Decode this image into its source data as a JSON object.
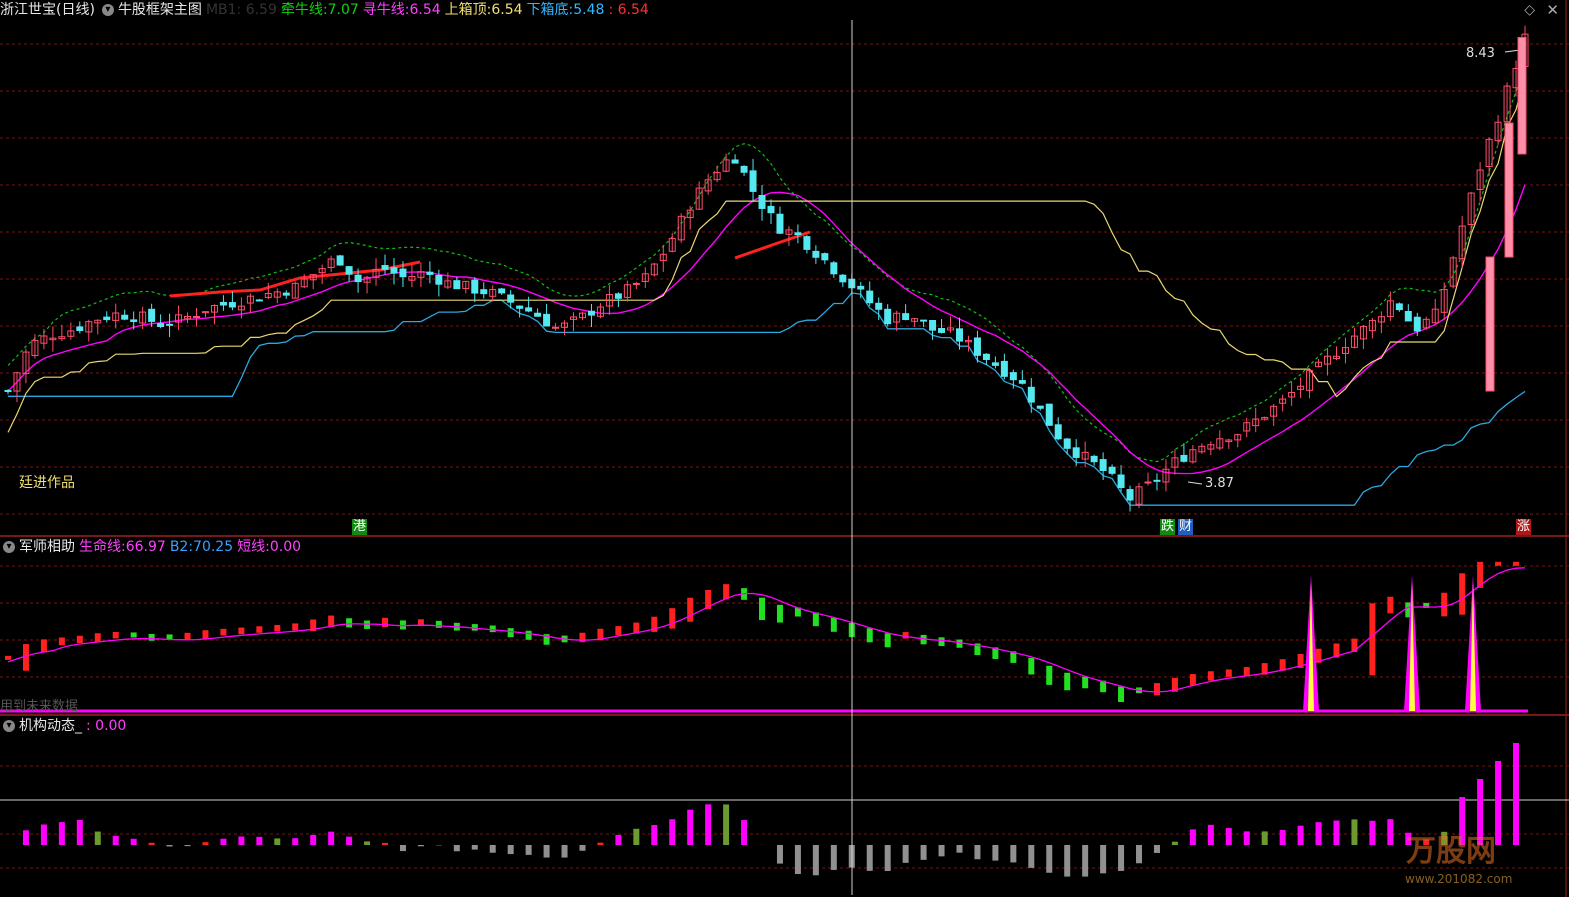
{
  "colors": {
    "up": "#ff4d6d",
    "up_fill": "#ff8fa8",
    "down": "#54e8f0",
    "ma_green": "#10c010",
    "magenta": "#ff00ff",
    "red_line": "#ff2020",
    "yellow_line": "#e8d870",
    "blue_line": "#2aa8e0",
    "grid": "#7a1515",
    "white": "#dddddd",
    "yellow": "#ffff40",
    "purple": "#b5318f",
    "gray": "#909090",
    "olive": "#6a9a30"
  },
  "header": {
    "title": "浙江世宝(日线)",
    "template": "牛股框架主图",
    "mb1_label": "MB1: 6.59",
    "qianniu_label": "牵牛线:",
    "qianniu_value": "7.07",
    "xunniu_label": "寻牛线:",
    "xunniu_value": "6.54",
    "shang_label": "上箱顶:",
    "shang_value": "6.54",
    "xia_label": "下箱底:",
    "xia_value": "5.48",
    "extra_value": ": 6.54"
  },
  "main_panel": {
    "signature": "廷进作品",
    "price_high_label": "8.43",
    "price_low_label": "3.87",
    "tags": [
      {
        "text": "港",
        "color": "#128a12"
      },
      {
        "text": "跌",
        "color": "#128a12"
      },
      {
        "text": "财",
        "color": "#1f5fbf"
      },
      {
        "text": "涨",
        "color": "#b01818"
      }
    ]
  },
  "panel2": {
    "name": "军师相助",
    "smx_label": "生命线:",
    "smx_value": "66.97",
    "b2_label": "B2:",
    "b2_value": "70.25",
    "dx_label": "短线:",
    "dx_value": "0.00",
    "warning": "用到未来数据"
  },
  "panel3": {
    "name": "机构动态_",
    "value": ": 0.00"
  },
  "watermark": {
    "text": "万股网",
    "url": "www.201082.com"
  },
  "icons": [
    "chevron-down-icon",
    "diamond-icon",
    "close-icon"
  ],
  "chart_data": [
    {
      "type": "candlestick",
      "title": "浙江世宝(日线)",
      "price_extremes": {
        "high": 8.43,
        "low": 3.87
      },
      "indicators": {
        "牵牛线": 7.07,
        "寻牛线": 6.54,
        "上箱顶": 6.54,
        "下箱底": 5.48
      },
      "close_path": [
        5.0,
        5.45,
        5.55,
        5.6,
        5.7,
        5.75,
        5.72,
        5.65,
        5.7,
        5.8,
        5.85,
        5.9,
        5.95,
        6.0,
        6.15,
        6.3,
        6.05,
        6.2,
        6.1,
        6.15,
        6.05,
        6.0,
        5.95,
        5.85,
        5.75,
        5.6,
        5.7,
        5.85,
        5.95,
        6.1,
        6.4,
        6.8,
        7.1,
        7.3,
        6.9,
        6.6,
        6.5,
        6.3,
        6.1,
        5.9,
        5.7,
        5.75,
        5.6,
        5.55,
        5.4,
        5.25,
        5.1,
        4.8,
        4.5,
        4.35,
        4.2,
        3.95,
        4.1,
        4.3,
        4.45,
        4.55,
        4.6,
        4.75,
        4.9,
        5.1,
        5.3,
        5.5,
        5.65,
        5.9,
        5.6,
        5.75,
        6.5,
        7.2,
        7.8,
        8.43
      ]
    },
    {
      "type": "bar",
      "title": "军师相助",
      "series": [
        {
          "name": "生命线",
          "last": 66.97
        },
        {
          "name": "B2",
          "last": 70.25
        },
        {
          "name": "短线",
          "last": 0.0
        }
      ]
    },
    {
      "type": "bar",
      "title": "机构动态_",
      "series": [
        {
          "name": "",
          "last": 0.0
        }
      ]
    }
  ]
}
